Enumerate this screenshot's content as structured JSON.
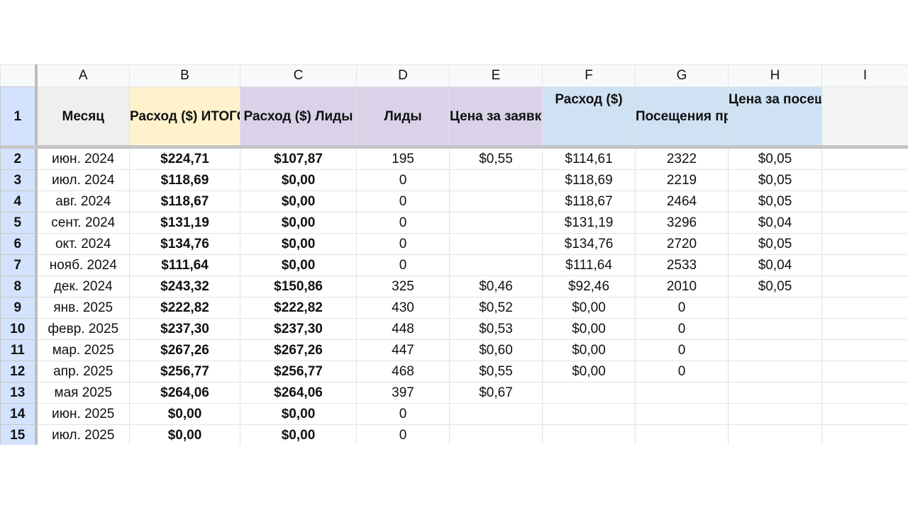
{
  "columns": [
    "A",
    "B",
    "C",
    "D",
    "E",
    "F",
    "G",
    "H",
    "I"
  ],
  "header_row_number": "1",
  "headers": {
    "a": "Месяц",
    "b": "Расход ($) ИТОГО",
    "c": "Расход ($) Лиды",
    "d": "Лиды",
    "e": "Цена за заявку ($)",
    "f": "Расход ($)",
    "g": "Посещения профиля",
    "h": "Цена за посещение ($)",
    "i": ""
  },
  "header_colors": {
    "month": "#efefef",
    "total": "#fff2cc",
    "leads": "#d9d2e9",
    "profile": "#cfe2f3"
  },
  "rows": [
    {
      "n": "2",
      "month": "июн. 2024",
      "total": "$224,71",
      "spend_leads": "$107,87",
      "leads": "195",
      "cpl": "$0,55",
      "spend": "$114,61",
      "visits": "2322",
      "cpv": "$0,05"
    },
    {
      "n": "3",
      "month": "июл. 2024",
      "total": "$118,69",
      "spend_leads": "$0,00",
      "leads": "0",
      "cpl": "",
      "spend": "$118,69",
      "visits": "2219",
      "cpv": "$0,05"
    },
    {
      "n": "4",
      "month": "авг. 2024",
      "total": "$118,67",
      "spend_leads": "$0,00",
      "leads": "0",
      "cpl": "",
      "spend": "$118,67",
      "visits": "2464",
      "cpv": "$0,05"
    },
    {
      "n": "5",
      "month": "сент. 2024",
      "total": "$131,19",
      "spend_leads": "$0,00",
      "leads": "0",
      "cpl": "",
      "spend": "$131,19",
      "visits": "3296",
      "cpv": "$0,04"
    },
    {
      "n": "6",
      "month": "окт. 2024",
      "total": "$134,76",
      "spend_leads": "$0,00",
      "leads": "0",
      "cpl": "",
      "spend": "$134,76",
      "visits": "2720",
      "cpv": "$0,05"
    },
    {
      "n": "7",
      "month": "нояб. 2024",
      "total": "$111,64",
      "spend_leads": "$0,00",
      "leads": "0",
      "cpl": "",
      "spend": "$111,64",
      "visits": "2533",
      "cpv": "$0,04"
    },
    {
      "n": "8",
      "month": "дек. 2024",
      "total": "$243,32",
      "spend_leads": "$150,86",
      "leads": "325",
      "cpl": "$0,46",
      "spend": "$92,46",
      "visits": "2010",
      "cpv": "$0,05"
    },
    {
      "n": "9",
      "month": "янв. 2025",
      "total": "$222,82",
      "spend_leads": "$222,82",
      "leads": "430",
      "cpl": "$0,52",
      "spend": "$0,00",
      "visits": "0",
      "cpv": ""
    },
    {
      "n": "10",
      "month": "февр. 2025",
      "total": "$237,30",
      "spend_leads": "$237,30",
      "leads": "448",
      "cpl": "$0,53",
      "spend": "$0,00",
      "visits": "0",
      "cpv": ""
    },
    {
      "n": "11",
      "month": "мар. 2025",
      "total": "$267,26",
      "spend_leads": "$267,26",
      "leads": "447",
      "cpl": "$0,60",
      "spend": "$0,00",
      "visits": "0",
      "cpv": ""
    },
    {
      "n": "12",
      "month": "апр. 2025",
      "total": "$256,77",
      "spend_leads": "$256,77",
      "leads": "468",
      "cpl": "$0,55",
      "spend": "$0,00",
      "visits": "0",
      "cpv": ""
    },
    {
      "n": "13",
      "month": "мая 2025",
      "total": "$264,06",
      "spend_leads": "$264,06",
      "leads": "397",
      "cpl": "$0,67",
      "spend": "",
      "visits": "",
      "cpv": ""
    },
    {
      "n": "14",
      "month": "июн. 2025",
      "total": "$0,00",
      "spend_leads": "$0,00",
      "leads": "0",
      "cpl": "",
      "spend": "",
      "visits": "",
      "cpv": ""
    },
    {
      "n": "15",
      "month": "июл. 2025",
      "total": "$0,00",
      "spend_leads": "$0,00",
      "leads": "0",
      "cpl": "",
      "spend": "",
      "visits": "",
      "cpv": ""
    }
  ]
}
